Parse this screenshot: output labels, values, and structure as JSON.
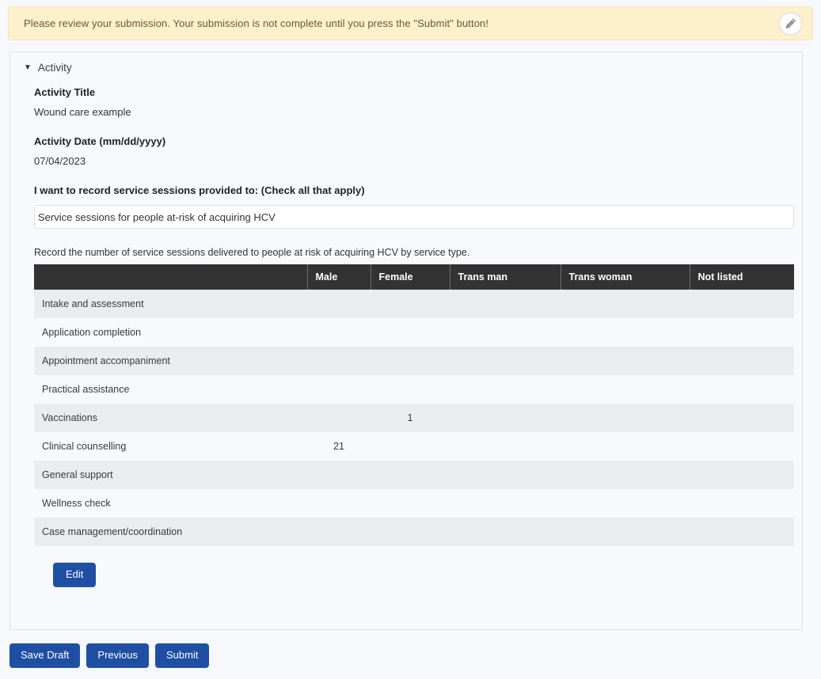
{
  "alert": {
    "message": "Please review your submission. Your submission is not complete until you press the \"Submit\" button!",
    "edit_icon": "pencil-circle-icon"
  },
  "panel": {
    "caret": "▼",
    "title": "Activity"
  },
  "form": {
    "activity_title_label": "Activity Title",
    "activity_title_value": "Wound care example",
    "activity_date_label": "Activity Date (mm/dd/yyyy)",
    "activity_date_value": "07/04/2023",
    "record_sessions_label": "I want to record service sessions provided to: (Check all that apply)",
    "record_sessions_value": "Service sessions for people at-risk of acquiring HCV",
    "table_intro": "Record the number of service sessions delivered to people at risk of acquiring HCV by service type."
  },
  "table": {
    "columns": [
      "",
      "Male",
      "Female",
      "Trans man",
      "Trans woman",
      "Not listed"
    ],
    "rows": [
      {
        "service": "Intake and assessment",
        "male": "",
        "female": "",
        "trans_man": "",
        "trans_woman": "",
        "not_listed": ""
      },
      {
        "service": "Application completion",
        "male": "",
        "female": "",
        "trans_man": "",
        "trans_woman": "",
        "not_listed": ""
      },
      {
        "service": "Appointment accompaniment",
        "male": "",
        "female": "",
        "trans_man": "",
        "trans_woman": "",
        "not_listed": ""
      },
      {
        "service": "Practical assistance",
        "male": "",
        "female": "",
        "trans_man": "",
        "trans_woman": "",
        "not_listed": ""
      },
      {
        "service": "Vaccinations",
        "male": "",
        "female": "1",
        "trans_man": "",
        "trans_woman": "",
        "not_listed": ""
      },
      {
        "service": "Clinical counselling",
        "male": "21",
        "female": "",
        "trans_man": "",
        "trans_woman": "",
        "not_listed": ""
      },
      {
        "service": "General support",
        "male": "",
        "female": "",
        "trans_man": "",
        "trans_woman": "",
        "not_listed": ""
      },
      {
        "service": "Wellness check",
        "male": "",
        "female": "",
        "trans_man": "",
        "trans_woman": "",
        "not_listed": ""
      },
      {
        "service": "Case management/coordination",
        "male": "",
        "female": "",
        "trans_man": "",
        "trans_woman": "",
        "not_listed": ""
      }
    ]
  },
  "buttons": {
    "edit": "Edit",
    "save_draft": "Save Draft",
    "previous": "Previous",
    "submit": "Submit"
  },
  "colors": {
    "alert_bg": "#fdf0cd",
    "alert_text": "#6a5a2a",
    "panel_bg": "#f7f9fc",
    "table_header_bg": "#333333",
    "row_odd": "#ebecef",
    "row_even": "#f7f9fc",
    "button_blue": "#1f4fa3"
  }
}
